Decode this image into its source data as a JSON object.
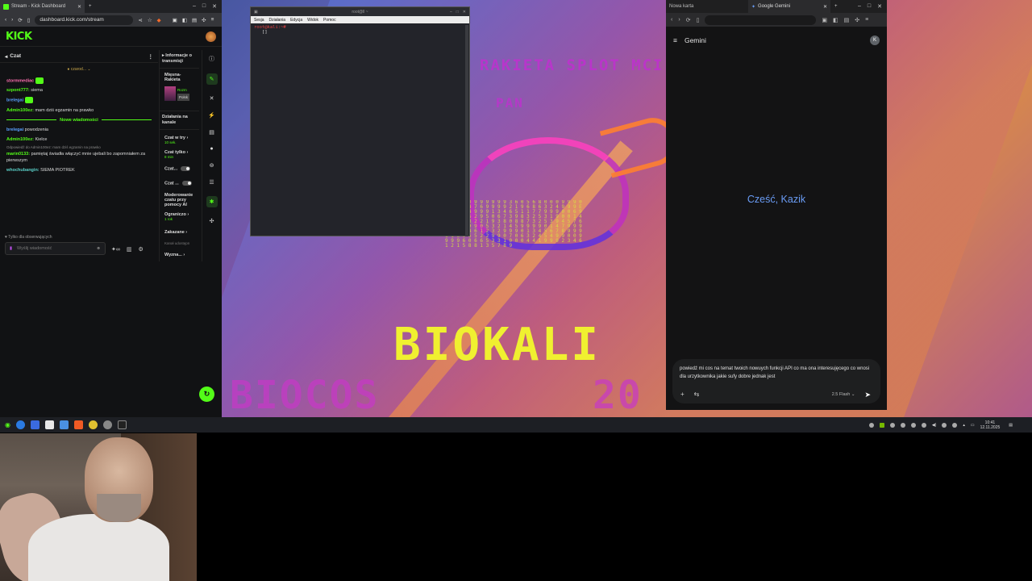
{
  "kick_window": {
    "tab_title": "Stream - Kick Dashboard",
    "url": "dashboard.kick.com/stream",
    "logo": "KICK",
    "chat": {
      "title": "Czat",
      "pinned": "czarod...",
      "messages": [
        {
          "user": "stormmediac",
          "text": "",
          "color": "pink",
          "badge": true
        },
        {
          "user": "szpont777:",
          "text": "siema",
          "color": "green"
        },
        {
          "user": "brelegai",
          "text": "",
          "color": "blue",
          "badge": true
        },
        {
          "user": "Admin100ez:",
          "text": "mam dziś egzamin na prawko",
          "color": "green"
        }
      ],
      "new_messages_label": "Nowe wiadomości",
      "messages_after": [
        {
          "user": "brelegai",
          "text": "powodzenia",
          "color": "blue"
        },
        {
          "user": "Admin100ez:",
          "text": "Kielce",
          "color": "green"
        }
      ],
      "reply_note": "Odpowiedź do Admin100ez: mam dziś egzamin na prawko",
      "reply_msg": {
        "user": "marin0133:",
        "text": "pamiętaj świadła włączyć mnie ujebali bo zapomniałem za pierwszym"
      },
      "last_msg": {
        "user": "whochubangin:",
        "text": "SIEMA PIOTREK"
      },
      "followers_only": "Tylko dla obserwujących",
      "input_placeholder": "Wyślij wiadomość"
    },
    "side_panel": {
      "info_title": "Informacje o transmisji",
      "stream_name": "Mięsna-Rakieta",
      "thumb_label_1": "Rozm",
      "thumb_label_2": "Polsk",
      "actions_title": "Działania na kanale",
      "slow_mode": "Czat w try",
      "slow_mode_sub": "10 sek.",
      "followers_mode": "Czat tylko",
      "followers_mode_sub": "8 min",
      "chat_toggle_1": "Czat...",
      "chat_toggle_2": "Czat ...",
      "ai_moderation": "Moderowanie czatu przy pomocy AI",
      "limit": "Ograniczo",
      "limit_sub": "1 rok",
      "banned": "Zakazane",
      "channel_share": "Kanał udostępn",
      "highlight": "Wyzna..."
    }
  },
  "terminal": {
    "title": "root@ll ~",
    "menu": [
      "Sesja",
      "Działania",
      "Edycja",
      "Widok",
      "Pomoc"
    ],
    "prompt": "root@kali:~# ",
    "cursor_line": "[]"
  },
  "wallpaper": {
    "top_text": "RAKIETA SPLOT MCI",
    "top_text_2": "PAN",
    "brand": "BIOKALI",
    "bottom_left": "BIOCOS",
    "bottom_right": "20",
    "matrix": "0 0 9 1 0 9 9 9 9 9 9 3 6 0 5 6 8 0 0 0 9 9 9 0 9 3 2 1 4 7 6 9 9 9 9 2 1 9 6 8 6 3 2 4 9 9 9 E 5 2 8 9 4 9 9 9 1 3 4 6 5 1 1 7 7 9 9 9 0 0 6 9 2 3 4 5 6 2 9 5 0 6 7 3 9 8 3 2 5 3 1 9 0 0 1 4 8 8 7 5 3 2 2 1 9 3 8 0 8 8 7 3 2 5 3 9 4 5 7 6 7 9 9 9 9 9 0 5 3 2 1 4 5 9 9 9 9 0 1 4 7 9 9 9 9 5 3 3 4 6 1 2 3 2 9 9 9 0 1 3 4 5 6 7 8 9 9 9 1 1 6 9 6 5 2 2 9 9 0 7 0 6 3 2 4 5 4 9 9 0 0 9 9 9 9 6 0 6 6 5 3 3 1 0 0 0 4 4 1 9 9 9 2 3 4 6 1 2 1 5 8 8 1 3 5 7 8 9"
  },
  "gemini_window": {
    "tab_1": "Nowa karta",
    "tab_2": "Google Gemini",
    "app_name": "Gemini",
    "avatar_letter": "K",
    "greeting": "Cześć, Kazik",
    "prompt_text": "powiedź mi cos na temat twoich nowuych funkcji API co ma ona interesujęcego co wnosi dla urzytkownika jakie sufy dobre jednak jest",
    "model": "2.5 Flash"
  },
  "taskbar": {
    "time": "10:41",
    "date": "12.11.2025"
  },
  "colors": {
    "kick_green": "#53fc18",
    "gemini_blue": "#6a9cf5"
  }
}
